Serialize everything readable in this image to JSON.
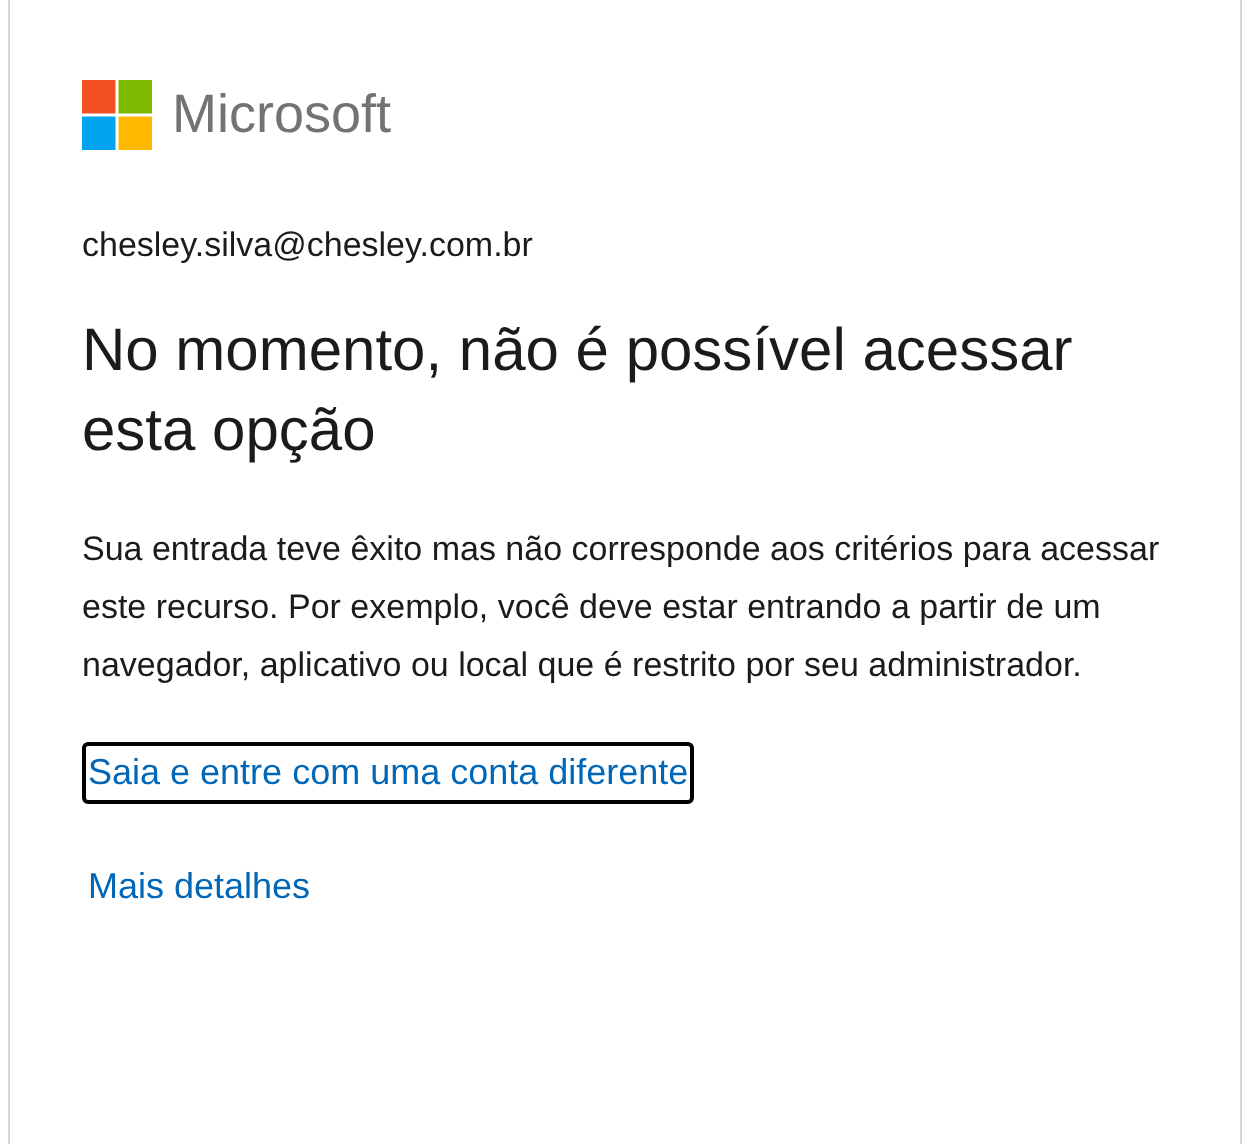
{
  "brand": {
    "name": "Microsoft"
  },
  "account": "chesley.silva@chesley.com.br",
  "title": "No momento, não é possível acessar esta opção",
  "message": "Sua entrada teve êxito mas não corresponde aos critérios para acessar este recurso. Por exemplo, você deve estar entrando a partir de um navegador, aplicativo ou local que é restrito por seu administrador.",
  "links": [
    {
      "label": "Saia e entre com uma conta diferente",
      "focused": true
    },
    {
      "label": "Mais detalhes",
      "focused": false
    }
  ]
}
